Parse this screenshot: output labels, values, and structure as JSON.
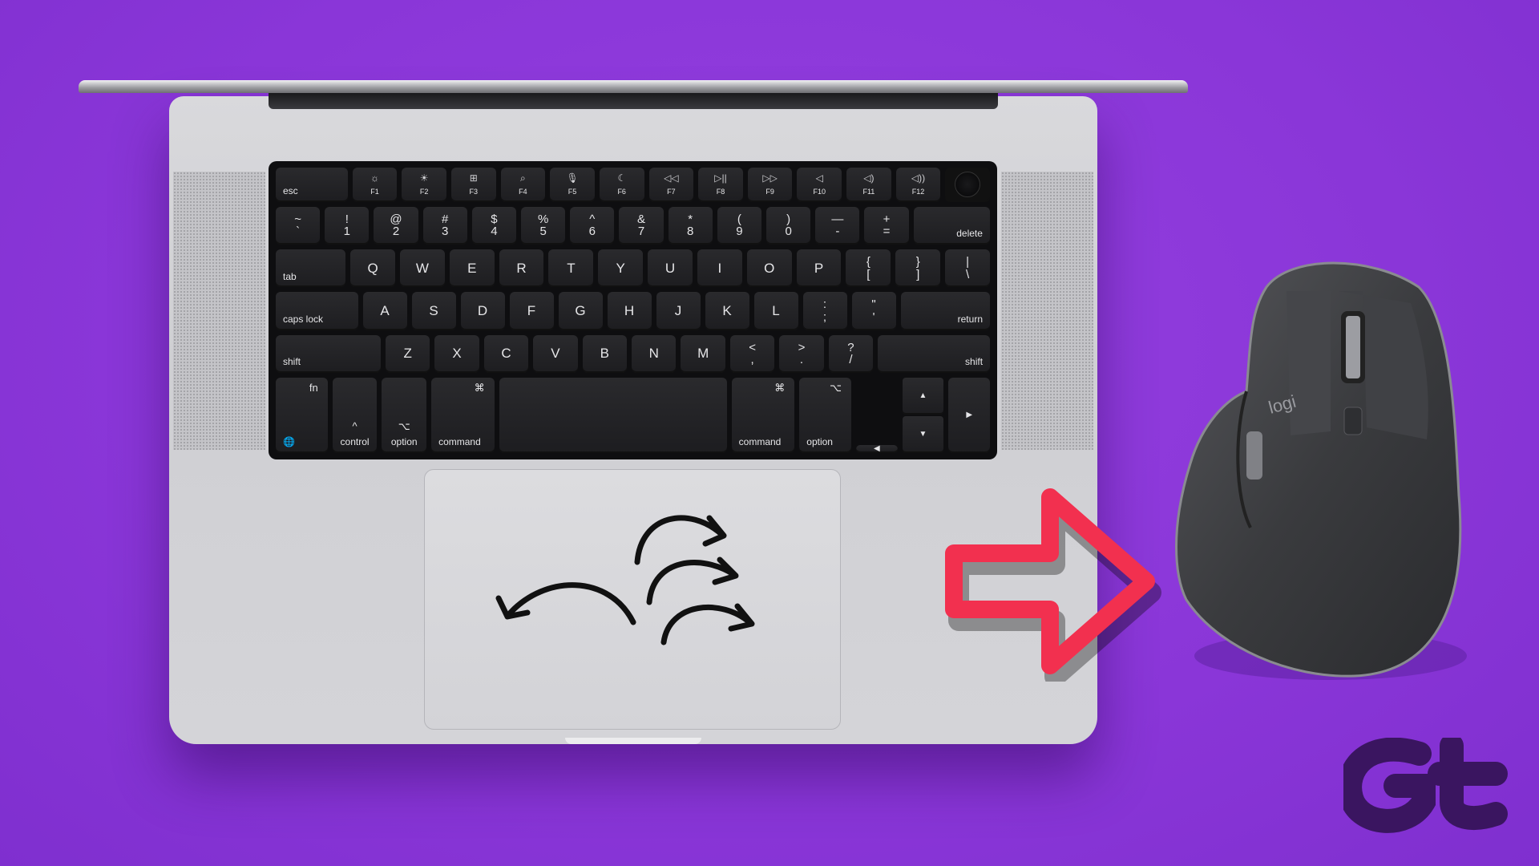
{
  "keyboard": {
    "rows": [
      [
        {
          "l": "esc",
          "k": "mod",
          "w": 1.45
        },
        {
          "t": "☼",
          "b": "F1",
          "k": "fnk"
        },
        {
          "t": "☀",
          "b": "F2",
          "k": "fnk"
        },
        {
          "t": "⊞",
          "b": "F3",
          "k": "fnk"
        },
        {
          "t": "⌕",
          "b": "F4",
          "k": "fnk"
        },
        {
          "t": "🎙",
          "b": "F5",
          "k": "fnk"
        },
        {
          "t": "☾",
          "b": "F6",
          "k": "fnk"
        },
        {
          "t": "◁◁",
          "b": "F7",
          "k": "fnk"
        },
        {
          "t": "▷||",
          "b": "F8",
          "k": "fnk"
        },
        {
          "t": "▷▷",
          "b": "F9",
          "k": "fnk"
        },
        {
          "t": "◁",
          "b": "F10",
          "k": "fnk"
        },
        {
          "t": "◁)",
          "b": "F11",
          "k": "fnk"
        },
        {
          "t": "◁))",
          "b": "F12",
          "k": "fnk"
        },
        {
          "k": "touch"
        }
      ],
      [
        {
          "t": "~",
          "b": "`",
          "k": "two"
        },
        {
          "t": "!",
          "b": "1",
          "k": "two"
        },
        {
          "t": "@",
          "b": "2",
          "k": "two"
        },
        {
          "t": "#",
          "b": "3",
          "k": "two"
        },
        {
          "t": "$",
          "b": "4",
          "k": "two"
        },
        {
          "t": "%",
          "b": "5",
          "k": "two"
        },
        {
          "t": "^",
          "b": "6",
          "k": "two"
        },
        {
          "t": "&",
          "b": "7",
          "k": "two"
        },
        {
          "t": "*",
          "b": "8",
          "k": "two"
        },
        {
          "t": "(",
          "b": "9",
          "k": "two"
        },
        {
          "t": ")",
          "b": "0",
          "k": "two"
        },
        {
          "t": "—",
          "b": "-",
          "k": "two"
        },
        {
          "t": "+",
          "b": "=",
          "k": "two"
        },
        {
          "l": "delete",
          "k": "mod right",
          "w": 1.4
        }
      ],
      [
        {
          "l": "tab",
          "k": "mod",
          "w": 1.4
        },
        {
          "c": "Q"
        },
        {
          "c": "W"
        },
        {
          "c": "E"
        },
        {
          "c": "R"
        },
        {
          "c": "T"
        },
        {
          "c": "Y"
        },
        {
          "c": "U"
        },
        {
          "c": "I"
        },
        {
          "c": "O"
        },
        {
          "c": "P"
        },
        {
          "t": "{",
          "b": "[",
          "k": "two"
        },
        {
          "t": "}",
          "b": "]",
          "k": "two"
        },
        {
          "t": "|",
          "b": "\\",
          "k": "two"
        }
      ],
      [
        {
          "l": "caps lock",
          "k": "mod",
          "w": 1.7
        },
        {
          "c": "A"
        },
        {
          "c": "S"
        },
        {
          "c": "D"
        },
        {
          "c": "F"
        },
        {
          "c": "G"
        },
        {
          "c": "H"
        },
        {
          "c": "J"
        },
        {
          "c": "K"
        },
        {
          "c": "L"
        },
        {
          "t": ":",
          "b": ";",
          "k": "two"
        },
        {
          "t": "\"",
          "b": "'",
          "k": "two"
        },
        {
          "l": "return",
          "k": "mod right",
          "w": 1.7
        }
      ],
      [
        {
          "l": "shift",
          "k": "mod",
          "w": 2.2
        },
        {
          "c": "Z"
        },
        {
          "c": "X"
        },
        {
          "c": "C"
        },
        {
          "c": "V"
        },
        {
          "c": "B"
        },
        {
          "c": "N"
        },
        {
          "c": "M"
        },
        {
          "t": "<",
          "b": ",",
          "k": "two"
        },
        {
          "t": ">",
          "b": ".",
          "k": "two"
        },
        {
          "t": "?",
          "b": "/",
          "k": "two"
        },
        {
          "l": "shift",
          "k": "mod right",
          "w": 2.2
        }
      ],
      [
        {
          "l": "🌐",
          "t": "fn",
          "k": "mod"
        },
        {
          "l": "control",
          "t": "^",
          "k": "mod center"
        },
        {
          "l": "option",
          "t": "⌥",
          "k": "mod center"
        },
        {
          "l": "command",
          "t": "⌘",
          "k": "mod",
          "w": 1.25
        },
        {
          "k": "space",
          "w": 5.1
        },
        {
          "l": "command",
          "t": "⌘",
          "k": "mod",
          "w": 1.25
        },
        {
          "l": "option",
          "t": "⌥",
          "k": "mod"
        },
        {
          "k": "arrows",
          "w": 3
        }
      ]
    ]
  },
  "arrow_keys": {
    "left": "◀",
    "up": "▲",
    "down": "▼",
    "right": "▶"
  },
  "mouse": {
    "brand": "logi"
  },
  "logo": {
    "text": "Gt"
  },
  "colors": {
    "background": "#8a36d8",
    "arrow": "#f2304f",
    "mouse": "#3c3d40"
  }
}
